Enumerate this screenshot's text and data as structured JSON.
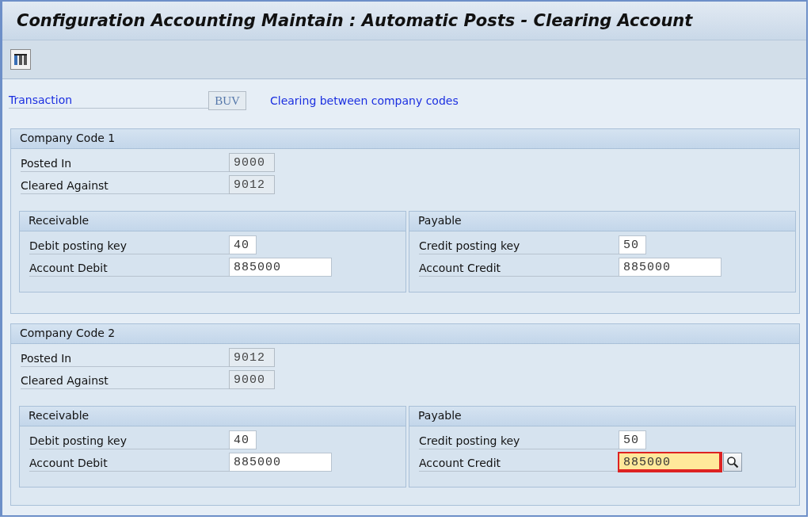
{
  "title": "Configuration Accounting Maintain : Automatic Posts - Clearing Account",
  "transaction": {
    "label": "Transaction",
    "value": "BUV",
    "description": "Clearing between company codes"
  },
  "groups": [
    {
      "title": "Company Code 1",
      "fields": [
        {
          "label": "Posted In",
          "value": "9000",
          "kind": "code",
          "editable": false,
          "focused": false
        },
        {
          "label": "Cleared Against",
          "value": "9012",
          "kind": "code",
          "editable": false,
          "focused": false
        }
      ],
      "subgroups": [
        {
          "title": "Receivable",
          "fields": [
            {
              "label": "Debit posting key",
              "value": "40",
              "kind": "key",
              "editable": true,
              "focused": false
            },
            {
              "label": "Account Debit",
              "value": "885000",
              "kind": "account",
              "editable": true,
              "focused": false
            }
          ]
        },
        {
          "title": "Payable",
          "fields": [
            {
              "label": "Credit posting key",
              "value": "50",
              "kind": "key",
              "editable": true,
              "focused": false
            },
            {
              "label": "Account Credit",
              "value": "885000",
              "kind": "account",
              "editable": true,
              "focused": false
            }
          ]
        }
      ]
    },
    {
      "title": "Company Code 2",
      "fields": [
        {
          "label": "Posted In",
          "value": "9012",
          "kind": "code",
          "editable": false,
          "focused": false
        },
        {
          "label": "Cleared Against",
          "value": "9000",
          "kind": "code",
          "editable": false,
          "focused": false
        }
      ],
      "subgroups": [
        {
          "title": "Receivable",
          "fields": [
            {
              "label": "Debit posting key",
              "value": "40",
              "kind": "key",
              "editable": true,
              "focused": false
            },
            {
              "label": "Account Debit",
              "value": "885000",
              "kind": "account",
              "editable": true,
              "focused": false
            }
          ]
        },
        {
          "title": "Payable",
          "fields": [
            {
              "label": "Credit posting key",
              "value": "50",
              "kind": "key",
              "editable": true,
              "focused": false
            },
            {
              "label": "Account Credit",
              "value": "885000",
              "kind": "account",
              "editable": true,
              "focused": true
            }
          ]
        }
      ]
    }
  ]
}
